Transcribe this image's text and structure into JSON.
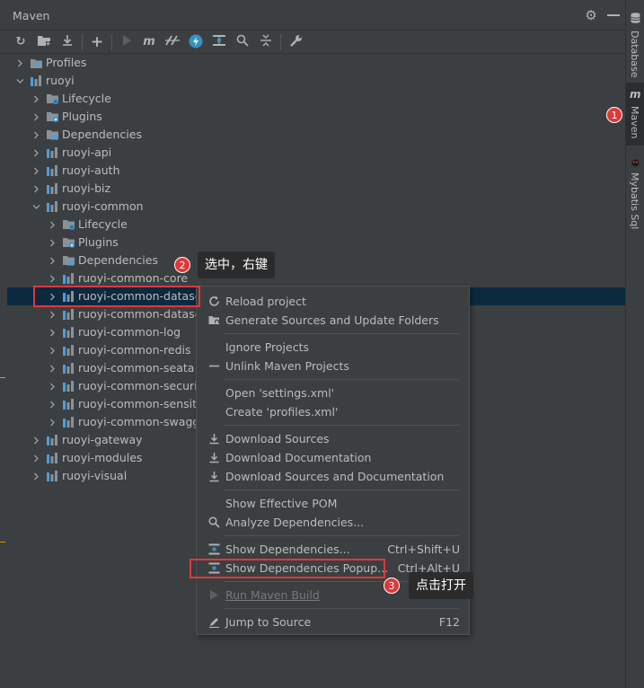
{
  "panel": {
    "title": "Maven"
  },
  "toolbar": {
    "icons": [
      "refresh-icon",
      "add-folder-icon",
      "download-icon",
      "add-icon",
      "run-icon",
      "maven-m-icon",
      "skip-tests-icon",
      "lightning-icon",
      "show-dependencies-icon",
      "search-icon",
      "collapse-icon",
      "wrench-icon"
    ]
  },
  "tree": {
    "rows": [
      {
        "label": "Profiles",
        "depth": 0,
        "chevron": ">",
        "icon": "profiles"
      },
      {
        "label": "ruoyi",
        "depth": 0,
        "chevron": "v",
        "icon": "module"
      },
      {
        "label": "Lifecycle",
        "depth": 1,
        "chevron": ">",
        "icon": "lifecycle"
      },
      {
        "label": "Plugins",
        "depth": 1,
        "chevron": ">",
        "icon": "plugins"
      },
      {
        "label": "Dependencies",
        "depth": 1,
        "chevron": ">",
        "icon": "dependencies"
      },
      {
        "label": "ruoyi-api",
        "depth": 1,
        "chevron": ">",
        "icon": "module"
      },
      {
        "label": "ruoyi-auth",
        "depth": 1,
        "chevron": ">",
        "icon": "module"
      },
      {
        "label": "ruoyi-biz",
        "depth": 1,
        "chevron": ">",
        "icon": "module"
      },
      {
        "label": "ruoyi-common",
        "depth": 1,
        "chevron": "v",
        "icon": "module"
      },
      {
        "label": "Lifecycle",
        "depth": 2,
        "chevron": ">",
        "icon": "lifecycle"
      },
      {
        "label": "Plugins",
        "depth": 2,
        "chevron": ">",
        "icon": "plugins"
      },
      {
        "label": "Dependencies",
        "depth": 2,
        "chevron": ">",
        "icon": "dependencies"
      },
      {
        "label": "ruoyi-common-core",
        "depth": 2,
        "chevron": ">",
        "icon": "module"
      },
      {
        "label": "ruoyi-common-datasco",
        "depth": 2,
        "chevron": ">",
        "icon": "module",
        "selected": true
      },
      {
        "label": "ruoyi-common-dataso",
        "depth": 2,
        "chevron": ">",
        "icon": "module"
      },
      {
        "label": "ruoyi-common-log",
        "depth": 2,
        "chevron": ">",
        "icon": "module"
      },
      {
        "label": "ruoyi-common-redis",
        "depth": 2,
        "chevron": ">",
        "icon": "module"
      },
      {
        "label": "ruoyi-common-seata",
        "depth": 2,
        "chevron": ">",
        "icon": "module"
      },
      {
        "label": "ruoyi-common-security",
        "depth": 2,
        "chevron": ">",
        "icon": "module"
      },
      {
        "label": "ruoyi-common-sensitiv",
        "depth": 2,
        "chevron": ">",
        "icon": "module"
      },
      {
        "label": "ruoyi-common-swagge",
        "depth": 2,
        "chevron": ">",
        "icon": "module"
      },
      {
        "label": "ruoyi-gateway",
        "depth": 1,
        "chevron": ">",
        "icon": "module"
      },
      {
        "label": "ruoyi-modules",
        "depth": 1,
        "chevron": ">",
        "icon": "module"
      },
      {
        "label": "ruoyi-visual",
        "depth": 1,
        "chevron": ">",
        "icon": "module"
      }
    ]
  },
  "context_menu": {
    "groups": [
      [
        {
          "label": "Reload project",
          "icon": "refresh-icon",
          "shortcut": ""
        },
        {
          "label": "Generate Sources and Update Folders",
          "icon": "generate-sources-icon",
          "shortcut": ""
        }
      ],
      [
        {
          "label": "Ignore Projects",
          "icon": "",
          "shortcut": ""
        },
        {
          "label": "Unlink Maven Projects",
          "icon": "minus-icon",
          "shortcut": ""
        }
      ],
      [
        {
          "label": "Open 'settings.xml'",
          "icon": "",
          "shortcut": ""
        },
        {
          "label": "Create 'profiles.xml'",
          "icon": "",
          "shortcut": ""
        }
      ],
      [
        {
          "label": "Download Sources",
          "icon": "download-icon",
          "shortcut": ""
        },
        {
          "label": "Download Documentation",
          "icon": "download-icon",
          "shortcut": ""
        },
        {
          "label": "Download Sources and Documentation",
          "icon": "download-icon",
          "shortcut": ""
        }
      ],
      [
        {
          "label": "Show Effective POM",
          "icon": "",
          "shortcut": ""
        },
        {
          "label": "Analyze Dependencies...",
          "icon": "search-icon",
          "shortcut": ""
        }
      ],
      [
        {
          "label": "Show Dependencies...",
          "icon": "show-dependencies-icon",
          "shortcut": "Ctrl+Shift+U"
        },
        {
          "label": "Show Dependencies Popup...",
          "icon": "show-dependencies-icon",
          "shortcut": "Ctrl+Alt+U"
        }
      ],
      [
        {
          "label": "Run Maven Build",
          "icon": "run-icon",
          "shortcut": "",
          "disabled": true
        }
      ],
      [
        {
          "label": "Jump to Source",
          "icon": "edit-icon",
          "shortcut": "F12"
        }
      ]
    ]
  },
  "sidebar": {
    "tabs": [
      {
        "label": "Database",
        "icon": "database-icon"
      },
      {
        "label": "Maven",
        "icon": "maven-m-icon",
        "active": true
      },
      {
        "label": "Mybatis Sql",
        "icon": "mybatis-icon"
      }
    ]
  },
  "annotations": {
    "badge1": "1",
    "badge2": "2",
    "badge3": "3",
    "callout2": "选中，右键",
    "callout3": "点击打开"
  },
  "colors": {
    "background": "#3c3f41",
    "selection": "#0d293e",
    "annotation_red": "#e0383a",
    "callout_bg": "#2b2b2b"
  }
}
